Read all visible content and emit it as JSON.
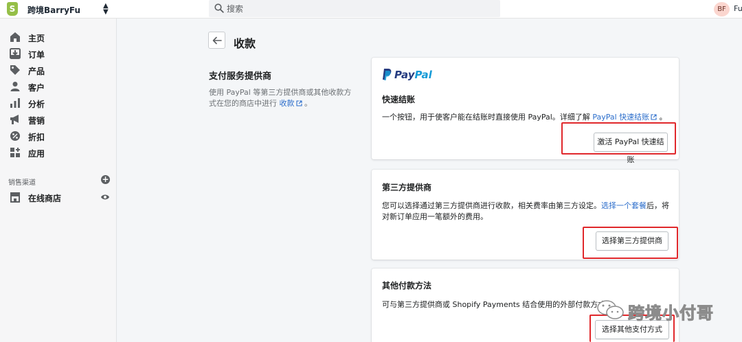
{
  "topbar": {
    "store_name": "跨境BarryFu",
    "search_placeholder": "搜索",
    "avatar_initials": "BF",
    "user_name": "Fu"
  },
  "sidebar": {
    "items": [
      {
        "label": "主页",
        "icon": "home-icon"
      },
      {
        "label": "订单",
        "icon": "orders-icon"
      },
      {
        "label": "产品",
        "icon": "tag-icon"
      },
      {
        "label": "客户",
        "icon": "person-icon"
      },
      {
        "label": "分析",
        "icon": "bar-chart-icon"
      },
      {
        "label": "营销",
        "icon": "megaphone-icon"
      },
      {
        "label": "折扣",
        "icon": "discount-icon"
      },
      {
        "label": "应用",
        "icon": "apps-icon"
      }
    ],
    "channels_label": "销售渠道",
    "channel_items": [
      {
        "label": "在线商店",
        "icon": "store-icon"
      }
    ]
  },
  "page": {
    "title": "收款"
  },
  "section": {
    "heading": "支付服务提供商",
    "desc_text": "使用 PayPal 等第三方提供商或其他收款方式在您的商店中进行",
    "desc_link": "收款",
    "desc_end": "。"
  },
  "cards": {
    "paypal": {
      "logo_text_1": "Pay",
      "logo_text_2": "Pal",
      "title": "快速结账",
      "text": "一个按钮，用于使客户能在结账时直接使用 PayPal。详细了解",
      "link": "PayPal 快速结账",
      "text_end": "。",
      "button": "激活 PayPal 快速结账"
    },
    "third_party": {
      "title": "第三方提供商",
      "text": "您可以选择通过第三方提供商进行收款，相关费率由第三方设定。",
      "link": "选择一个套餐",
      "text_end": "后，将对新订单应用一笔额外的费用。",
      "button": "选择第三方提供商"
    },
    "other": {
      "title": "其他付款方法",
      "text": "可与第三方提供商或 Shopify Payments 结合使用的外部付款方式。",
      "button": "选择其他支付方式"
    }
  },
  "watermark": {
    "text": "跨境小付哥"
  },
  "colors": {
    "shopify_green": "#95bf47",
    "link_blue": "#2c6ecb",
    "highlight_red": "#e0272b",
    "paypal_dark": "#253b80",
    "paypal_light": "#179bd7"
  }
}
